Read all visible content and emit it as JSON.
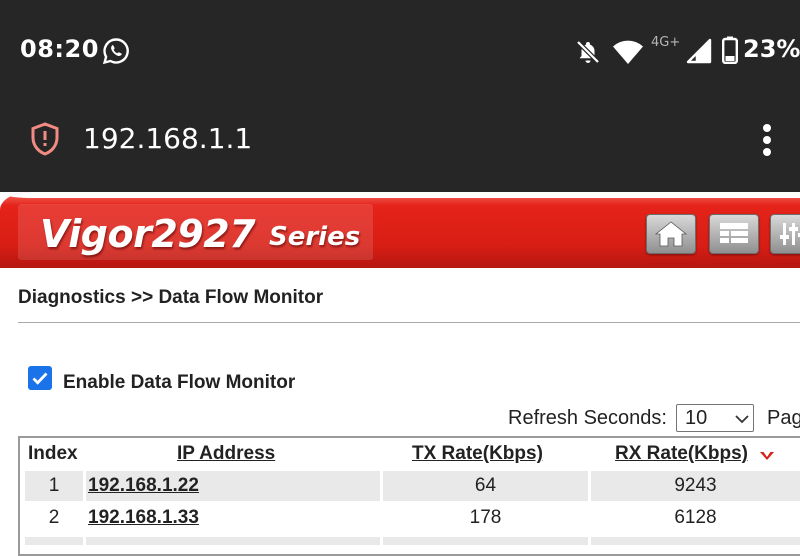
{
  "status_bar": {
    "time": "08:20",
    "network_type": "4G+",
    "battery": "23%",
    "icons": [
      "whatsapp-icon",
      "bell-off-icon",
      "wifi-icon",
      "signal-icon",
      "battery-icon"
    ]
  },
  "browser": {
    "url": "192.168.1.1",
    "icons": [
      "shield-warning-icon",
      "more-vert-icon"
    ]
  },
  "header": {
    "model": "Vigor2927",
    "series": "Series",
    "buttons": [
      "home-icon",
      "grid-icon",
      "settings-icon"
    ],
    "brand_color": "#d81e15"
  },
  "breadcrumb": "Diagnostics >> Data Flow Monitor",
  "enable_monitor": {
    "label": "Enable Data Flow Monitor",
    "checked": true
  },
  "refresh": {
    "label": "Refresh Seconds:",
    "value": "10",
    "page_label": "Page"
  },
  "table": {
    "columns": [
      "Index",
      "IP Address",
      "TX Rate(Kbps)",
      "RX Rate(Kbps)"
    ],
    "rows": [
      {
        "index": "1",
        "ip": "192.168.1.22",
        "tx": "64",
        "rx": "9243"
      },
      {
        "index": "2",
        "ip": "192.168.1.33",
        "tx": "178",
        "rx": "6128"
      }
    ]
  },
  "colors": {
    "status_bg": "#262626",
    "checkbox": "#1a73e8",
    "sort_arrow": "#d81e15"
  }
}
